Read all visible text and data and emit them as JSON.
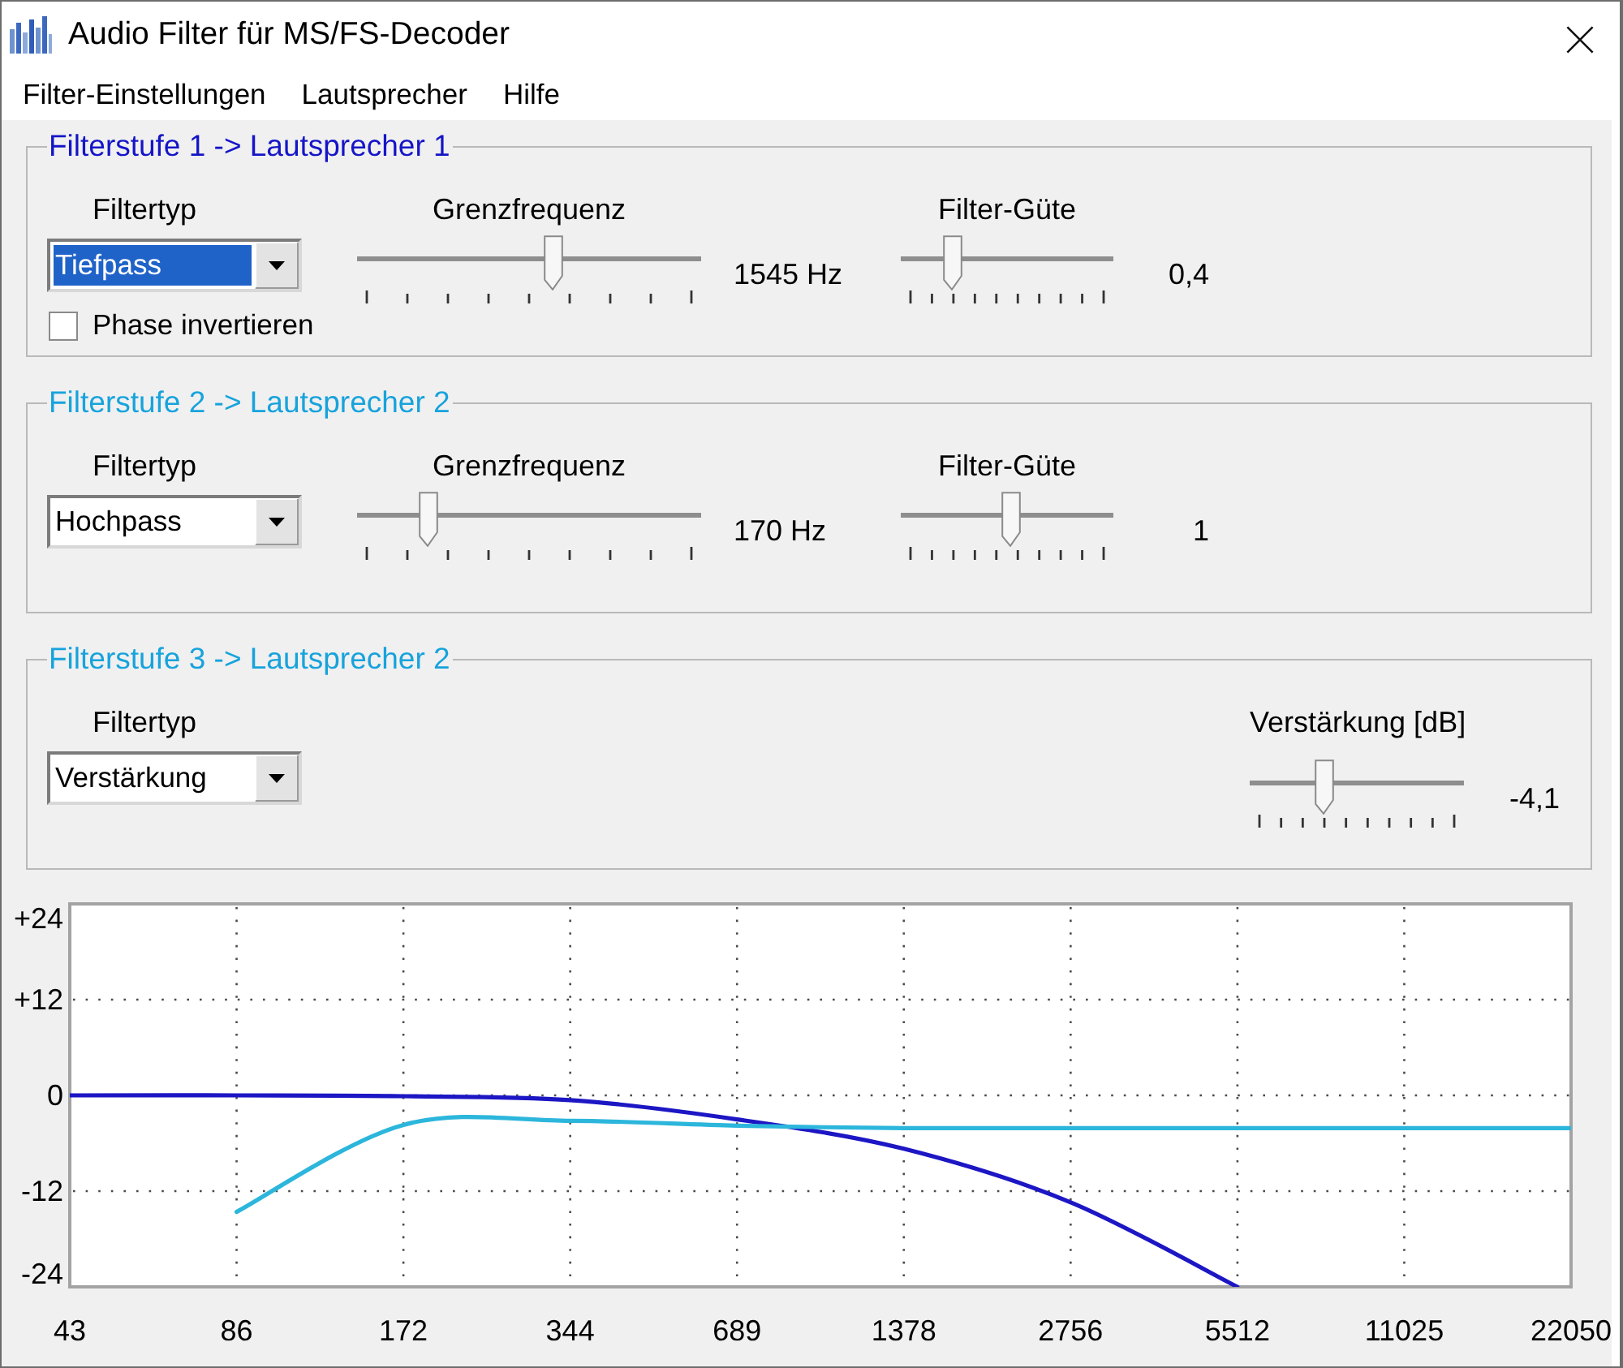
{
  "window": {
    "title": "Audio Filter für MS/FS-Decoder"
  },
  "menu": [
    "Filter-Einstellungen",
    "Lautsprecher",
    "Hilfe"
  ],
  "stages": [
    {
      "title": "Filterstufe 1 -> Lautsprecher 1",
      "color": "#1515c8",
      "filter_type": {
        "label": "Filtertyp",
        "value": "Tiefpass",
        "focused": true
      },
      "invert_phase": {
        "label": "Phase invertieren",
        "checked": false
      },
      "sliders": [
        {
          "kind": "frequency",
          "label": "Grenzfrequenz",
          "level": 0.575,
          "reading": "1545 Hz"
        },
        {
          "kind": "quality",
          "label": "Filter-Güte",
          "level": 0.22,
          "reading": "0,4"
        }
      ]
    },
    {
      "title": "Filterstufe 2 -> Lautsprecher 2",
      "color": "#17a3dc",
      "filter_type": {
        "label": "Filtertyp",
        "value": "Hochpass",
        "focused": false
      },
      "sliders": [
        {
          "kind": "frequency",
          "label": "Grenzfrequenz",
          "level": 0.19,
          "reading": "170 Hz"
        },
        {
          "kind": "quality",
          "label": "Filter-Güte",
          "level": 0.52,
          "reading": "1"
        }
      ]
    },
    {
      "title": "Filterstufe 3 -> Lautsprecher 2",
      "color": "#17a3dc",
      "filter_type": {
        "label": "Filtertyp",
        "value": "Verstärkung",
        "focused": false
      },
      "sliders": [
        {
          "kind": "gain",
          "label": "Verstärkung [dB]",
          "level": 0.33,
          "reading": "-4,1"
        }
      ]
    }
  ],
  "response_plot": {
    "chart_data": {
      "type": "line",
      "categories": [
        "43",
        "86",
        "172",
        "344",
        "689",
        "1378",
        "2756",
        "5512",
        "11025",
        "22050"
      ],
      "series": [
        {
          "color": "#1c16c4",
          "values": [
            0,
            0,
            -0.1,
            -0.6,
            -3,
            -6.7,
            -13.4,
            -24,
            null,
            null
          ]
        },
        {
          "color": "#2cb6dc",
          "values": [
            null,
            -14.6,
            -3.7,
            -3.2,
            -3.8,
            -4.1,
            -4.1,
            -4.1,
            -4.1,
            -4.1
          ]
        }
      ],
      "ylim": [
        -24,
        24
      ],
      "yticks": [
        {
          "value": 24,
          "label": "+24"
        },
        {
          "value": 12,
          "label": "+12"
        },
        0,
        -12,
        -24
      ],
      "grid": true
    }
  }
}
